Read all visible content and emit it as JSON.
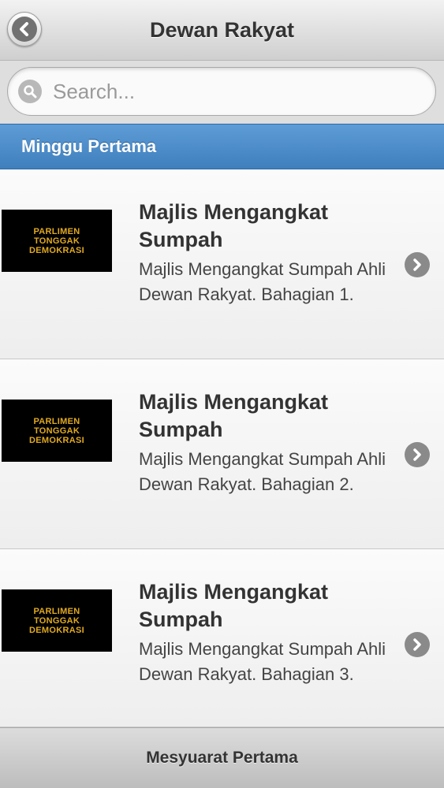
{
  "header": {
    "title": "Dewan Rakyat",
    "back_icon": "back-arrow-icon"
  },
  "search": {
    "placeholder": "Search...",
    "value": "",
    "icon": "search-icon"
  },
  "section": {
    "label": "Minggu Pertama",
    "color": "#4a8bc9"
  },
  "items": [
    {
      "thumb_line1": "PARLIMEN",
      "thumb_line2": "TONGGAK",
      "thumb_line3": "DEMOKRASI",
      "title": "Majlis Mengangkat Sumpah",
      "desc": "Majlis Mengangkat Sumpah Ahli Dewan Rakyat. Bahagian 1."
    },
    {
      "thumb_line1": "PARLIMEN",
      "thumb_line2": "TONGGAK",
      "thumb_line3": "DEMOKRASI",
      "title": "Majlis Mengangkat Sumpah",
      "desc": "Majlis Mengangkat Sumpah Ahli Dewan Rakyat. Bahagian 2."
    },
    {
      "thumb_line1": "PARLIMEN",
      "thumb_line2": "TONGGAK",
      "thumb_line3": "DEMOKRASI",
      "title": "Majlis Mengangkat Sumpah",
      "desc": "Majlis Mengangkat Sumpah Ahli Dewan Rakyat. Bahagian 3."
    }
  ],
  "footer": {
    "label": "Mesyuarat Pertama"
  }
}
